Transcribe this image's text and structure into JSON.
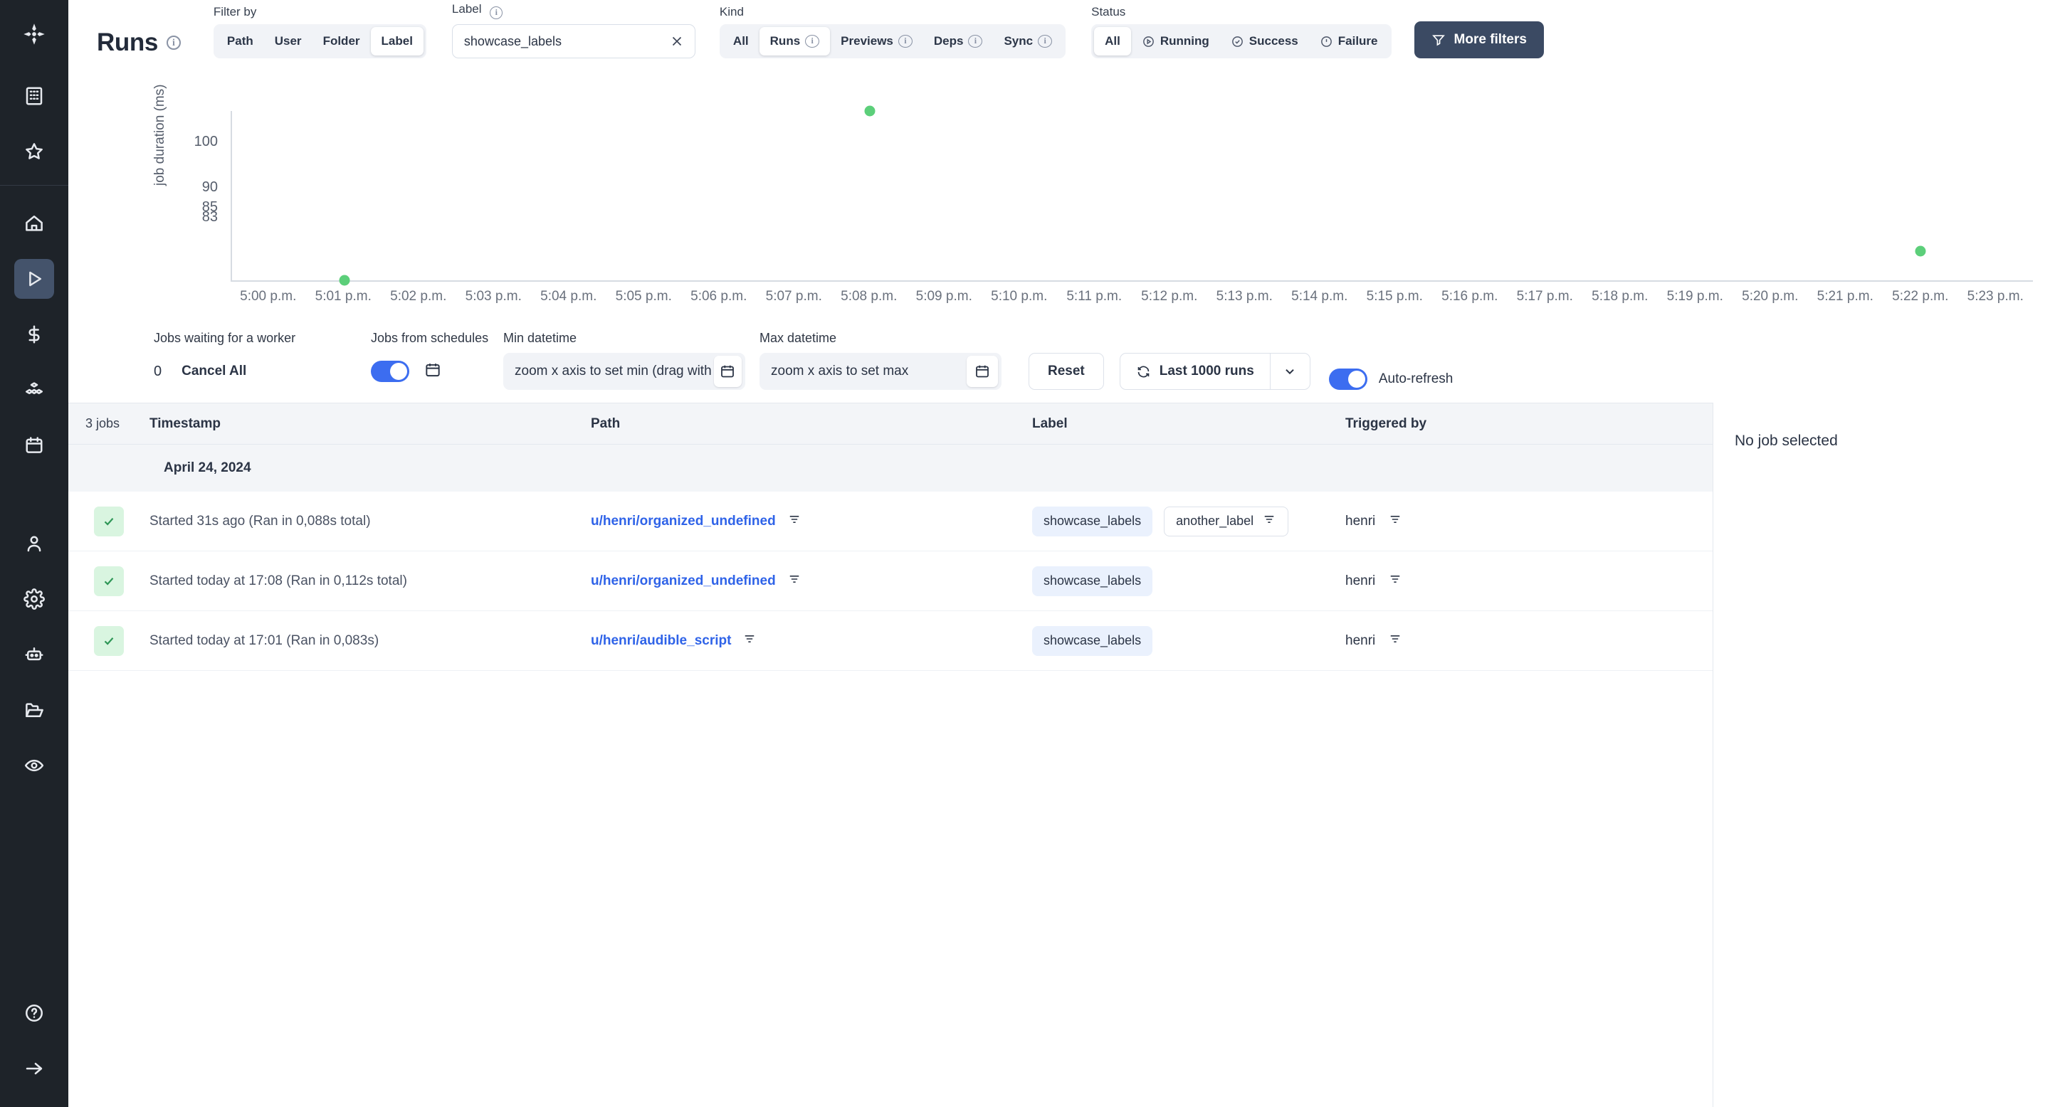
{
  "app": {
    "logo_icon": "windmill-logo-icon"
  },
  "rail": {
    "top_items": [
      {
        "icon": "building-icon",
        "name": "workspace-icon"
      },
      {
        "icon": "star-icon",
        "name": "favorites-icon"
      }
    ],
    "nav_items": [
      {
        "icon": "home-icon",
        "name": "home",
        "active": false
      },
      {
        "icon": "play-triangle-icon",
        "name": "runs",
        "active": true
      },
      {
        "icon": "dollar-icon",
        "name": "billing",
        "active": false
      },
      {
        "icon": "cubes-icon",
        "name": "resources",
        "active": false
      },
      {
        "icon": "calendar-icon",
        "name": "schedules",
        "active": false
      }
    ],
    "bottom_items": [
      {
        "icon": "user-icon",
        "name": "account"
      },
      {
        "icon": "gear-icon",
        "name": "settings"
      },
      {
        "icon": "robot-icon",
        "name": "workers"
      },
      {
        "icon": "folder-open-icon",
        "name": "folders"
      },
      {
        "icon": "eye-icon",
        "name": "audit-logs"
      }
    ],
    "footer_items": [
      {
        "icon": "question-circle-icon",
        "name": "help"
      },
      {
        "icon": "arrow-right-icon",
        "name": "expand-sidebar"
      }
    ]
  },
  "header": {
    "title": "Runs",
    "title_info_icon": "info-icon",
    "filter_by": {
      "label": "Filter by",
      "options": [
        {
          "label": "Path",
          "active": false
        },
        {
          "label": "User",
          "active": false
        },
        {
          "label": "Folder",
          "active": false
        },
        {
          "label": "Label",
          "active": true
        }
      ]
    },
    "label_filter": {
      "label": "Label",
      "info_icon": "info-icon",
      "value": "showcase_labels",
      "placeholder": "",
      "clear_icon": "close-icon"
    },
    "kind": {
      "label": "Kind",
      "options": [
        {
          "label": "All",
          "active": false,
          "info": false
        },
        {
          "label": "Runs",
          "active": true,
          "info": true
        },
        {
          "label": "Previews",
          "active": false,
          "info": true
        },
        {
          "label": "Deps",
          "active": false,
          "info": true
        },
        {
          "label": "Sync",
          "active": false,
          "info": true
        }
      ]
    },
    "status": {
      "label": "Status",
      "options": [
        {
          "label": "All",
          "active": true,
          "icon": ""
        },
        {
          "label": "Running",
          "active": false,
          "icon": "play-circle-icon"
        },
        {
          "label": "Success",
          "active": false,
          "icon": "check-circle-icon"
        },
        {
          "label": "Failure",
          "active": false,
          "icon": "alert-circle-icon"
        }
      ]
    },
    "more_filters": {
      "label": "More filters",
      "icon": "funnel-icon"
    }
  },
  "chart_data": {
    "type": "scatter",
    "title": "",
    "xlabel": "",
    "ylabel": "job duration (ms)",
    "yticks": [
      100,
      90,
      85,
      83
    ],
    "ylim": [
      83,
      112
    ],
    "grid": false,
    "legend": false,
    "xticks": [
      "5:00 p.m.",
      "5:01 p.m.",
      "5:02 p.m.",
      "5:03 p.m.",
      "5:04 p.m.",
      "5:05 p.m.",
      "5:06 p.m.",
      "5:07 p.m.",
      "5:08 p.m.",
      "5:09 p.m.",
      "5:10 p.m.",
      "5:11 p.m.",
      "5:12 p.m.",
      "5:13 p.m.",
      "5:14 p.m.",
      "5:15 p.m.",
      "5:16 p.m.",
      "5:17 p.m.",
      "5:18 p.m.",
      "5:19 p.m.",
      "5:20 p.m.",
      "5:21 p.m.",
      "5:22 p.m.",
      "5:23 p.m."
    ],
    "series": [
      {
        "name": "success",
        "color": "#5CCF7A",
        "points": [
          {
            "x": "5:01 p.m.",
            "y": 83
          },
          {
            "x": "5:08 p.m.",
            "y": 112
          },
          {
            "x": "5:22 p.m.",
            "y": 88
          }
        ]
      }
    ]
  },
  "controls": {
    "jobs_waiting": {
      "label": "Jobs waiting for a worker",
      "count": "0",
      "cancel_all": "Cancel All"
    },
    "jobs_from_schedules": {
      "label": "Jobs from schedules",
      "enabled": true,
      "calendar_icon": "calendar-icon"
    },
    "min_datetime": {
      "label": "Min datetime",
      "placeholder": "zoom x axis to set min (drag with ctrl)",
      "value": "",
      "calendar_icon": "calendar-icon"
    },
    "max_datetime": {
      "label": "Max datetime",
      "placeholder": "zoom x axis to set max",
      "value": "",
      "calendar_icon": "calendar-icon"
    },
    "reset": "Reset",
    "runs_select": {
      "label": "Last 1000 runs",
      "refresh_icon": "refresh-icon",
      "caret_icon": "chevron-down-icon"
    },
    "auto_refresh": {
      "label": "Auto-refresh",
      "enabled": true
    }
  },
  "table": {
    "count_label": "3 jobs",
    "columns": [
      "Timestamp",
      "Path",
      "Label",
      "Triggered by"
    ],
    "date_group": "April 24, 2024",
    "rows": [
      {
        "status": "success",
        "status_icon": "check-icon",
        "timestamp": "Started 31s ago (Ran in 0,088s total)",
        "path": "u/henri/organized_undefined",
        "path_filter_icon": "filter-icon",
        "labels": [
          {
            "text": "showcase_labels",
            "style": "blue",
            "filter_icon": ""
          },
          {
            "text": "another_label",
            "style": "plain",
            "filter_icon": "filter-icon"
          }
        ],
        "triggered_by": "henri",
        "trigger_filter_icon": "filter-icon"
      },
      {
        "status": "success",
        "status_icon": "check-icon",
        "timestamp": "Started today at 17:08 (Ran in 0,112s total)",
        "path": "u/henri/organized_undefined",
        "path_filter_icon": "filter-icon",
        "labels": [
          {
            "text": "showcase_labels",
            "style": "blue",
            "filter_icon": ""
          }
        ],
        "triggered_by": "henri",
        "trigger_filter_icon": "filter-icon"
      },
      {
        "status": "success",
        "status_icon": "check-icon",
        "timestamp": "Started today at 17:01 (Ran in 0,083s)",
        "path": "u/henri/audible_script",
        "path_filter_icon": "filter-icon",
        "labels": [
          {
            "text": "showcase_labels",
            "style": "blue",
            "filter_icon": ""
          }
        ],
        "triggered_by": "henri",
        "trigger_filter_icon": "filter-icon"
      }
    ]
  },
  "right_panel": {
    "empty_text": "No job selected"
  },
  "colors": {
    "accent": "#3c6df0",
    "link": "#2f63e8",
    "success": "#5CCF7A",
    "dark_button": "#3b4a63",
    "rail_bg": "#1e2329"
  }
}
